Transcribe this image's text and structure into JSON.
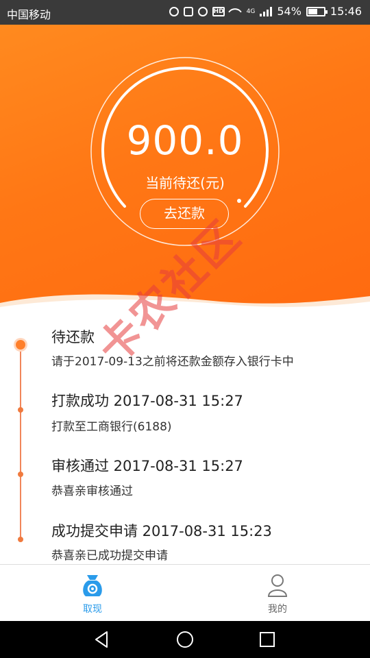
{
  "status_bar": {
    "carrier": "中国移动",
    "battery": "54%",
    "time": "15:46",
    "network": "4G",
    "hd_badge": "HD"
  },
  "summary": {
    "amount": "900.0",
    "amount_label": "当前待还(元)",
    "repay_button": "去还款"
  },
  "timeline": [
    {
      "title": "待还款",
      "desc": "请于2017-09-13之前将还款金额存入银行卡中"
    },
    {
      "title": "打款成功 2017-08-31 15:27",
      "desc": "打款至工商银行(6188)"
    },
    {
      "title": "审核通过 2017-08-31 15:27",
      "desc": "恭喜亲审核通过"
    },
    {
      "title": "成功提交申请 2017-08-31 15:23",
      "desc": "恭喜亲已成功提交申请"
    }
  ],
  "watermark": "卡农社区",
  "tabs": [
    {
      "label": "取现",
      "icon": "money-bag-icon",
      "active": true
    },
    {
      "label": "我的",
      "icon": "user-icon",
      "active": false
    }
  ],
  "colors": {
    "accent": "#ff7715",
    "tab_active": "#2a9bea",
    "timeline": "#f07a3e"
  }
}
